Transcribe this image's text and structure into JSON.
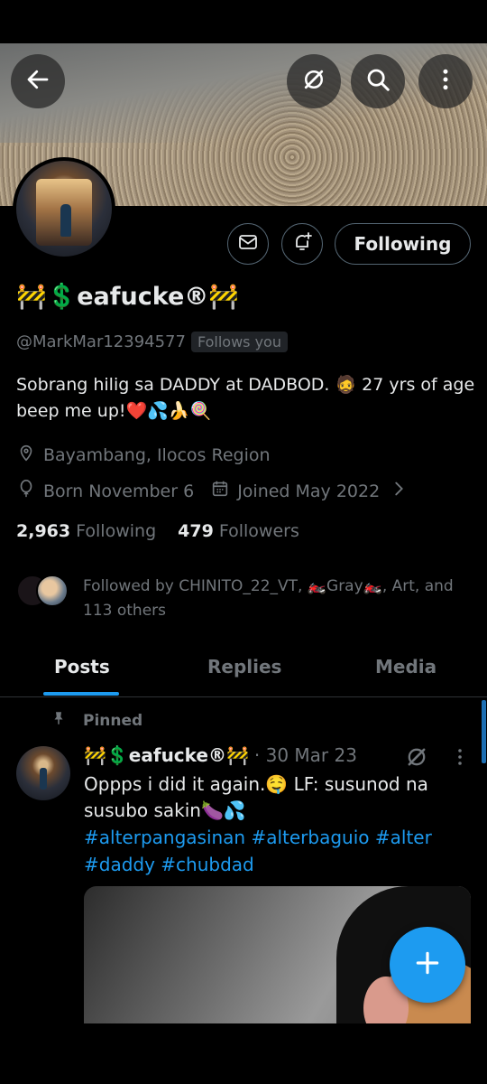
{
  "profile": {
    "display_name": "🚧💲eafucke®🚧",
    "handle": "@MarkMar12394577",
    "follows_you_badge": "Follows you",
    "bio": "Sobrang hilig sa DADDY at DADBOD. 🧔 27 yrs of age beep me up!❤️💦🍌🍭",
    "location": "Bayambang, Ilocos Region",
    "born": "Born November 6",
    "joined": "Joined May 2022",
    "following_count": "2,963",
    "following_label": "Following",
    "followers_count": "479",
    "followers_label": "Followers",
    "followed_by_text": "Followed by CHINITO_22_VT, 🏍️Gray🏍️, Art, and 113 others"
  },
  "actions": {
    "following_button": "Following"
  },
  "tabs": [
    {
      "label": "Posts",
      "active": true
    },
    {
      "label": "Replies",
      "active": false
    },
    {
      "label": "Media",
      "active": false
    }
  ],
  "post": {
    "pinned_label": "Pinned",
    "author_name": "🚧💲eafucke®🚧",
    "date": "· 30 Mar 23",
    "text": "Oppps i did it again.🤤 LF: susunod na susubo sakin🍆💦",
    "hashtags": "#alterpangasinan #alterbaguio #alter #daddy #chubdad"
  },
  "icons": {
    "back": "arrow-left-icon",
    "spaces": "grok-icon",
    "search": "search-icon",
    "more": "more-vertical-icon",
    "message": "mail-icon",
    "notify": "bell-plus-icon",
    "location": "location-pin-icon",
    "birthday": "balloon-icon",
    "calendar": "calendar-icon",
    "pin": "pin-icon",
    "compose": "plus-icon"
  },
  "colors": {
    "accent": "#1d9bf0",
    "text_primary": "#e7e9ea",
    "text_secondary": "#71767b",
    "background": "#000000"
  }
}
